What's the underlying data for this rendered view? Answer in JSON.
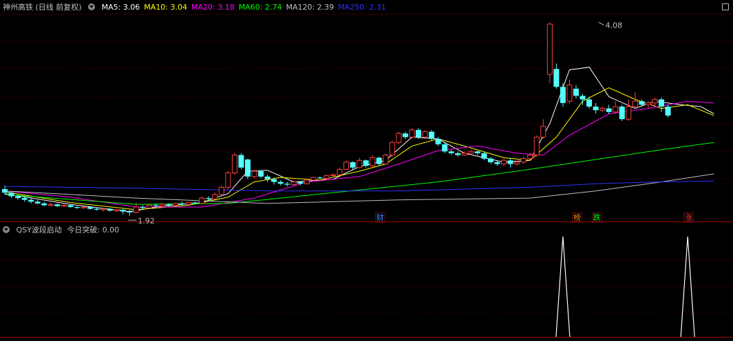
{
  "main_legend": {
    "title": "神州高铁 (日线 前复权)",
    "ma": [
      {
        "label": "MA5: 3.06",
        "color": "#ffffff"
      },
      {
        "label": "MA10: 3.04",
        "color": "#ffff00"
      },
      {
        "label": "MA20: 3.18",
        "color": "#ff00ff"
      },
      {
        "label": "MA60: 2.74",
        "color": "#00ff00"
      },
      {
        "label": "MA120: 2.39",
        "color": "#c0c0c0"
      },
      {
        "label": "MA250: 2.31",
        "color": "#3333ff"
      }
    ]
  },
  "indicator_legend": {
    "name": "QSY波段启动",
    "value_label": "今日突破: 0.00"
  },
  "events": [
    {
      "label": "财",
      "color": "#4488ff",
      "index": 57
    },
    {
      "label": "榜",
      "color": "#ff8800",
      "index": 87
    },
    {
      "label": "跌",
      "color": "#00ff00",
      "index": 90
    },
    {
      "label": "涨",
      "color": "#ff3030",
      "index": 104
    }
  ],
  "colors": {
    "up": "#ff4040",
    "down": "#54ffff",
    "grid": "#800000",
    "border": "#a00000",
    "signal": "#ffffff"
  },
  "chart_data": {
    "type": "candlestick",
    "annotations": {
      "high": {
        "label": "4.08",
        "value": 4.08,
        "index": 90
      },
      "low": {
        "label": "1.92",
        "value": 1.92,
        "index": 19
      }
    },
    "ylim": [
      1.86,
      4.16
    ],
    "candles": [
      [
        2.22,
        2.18,
        2.26,
        2.16
      ],
      [
        2.18,
        2.14,
        2.2,
        2.12
      ],
      [
        2.14,
        2.12,
        2.16,
        2.1
      ],
      [
        2.12,
        2.1,
        2.14,
        2.08
      ],
      [
        2.1,
        2.08,
        2.12,
        2.06
      ],
      [
        2.08,
        2.06,
        2.1,
        2.05
      ],
      [
        2.06,
        2.04,
        2.08,
        2.03
      ],
      [
        2.04,
        2.05,
        2.07,
        2.03
      ],
      [
        2.05,
        2.03,
        2.06,
        2.02
      ],
      [
        2.03,
        2.04,
        2.05,
        2.02
      ],
      [
        2.04,
        2.02,
        2.05,
        2.01
      ],
      [
        2.02,
        2.01,
        2.03,
        2.0
      ],
      [
        2.01,
        2.02,
        2.03,
        2.0
      ],
      [
        2.02,
        2.0,
        2.03,
        1.99
      ],
      [
        2.0,
        1.99,
        2.01,
        1.98
      ],
      [
        1.99,
        2.0,
        2.01,
        1.97
      ],
      [
        2.0,
        1.98,
        2.01,
        1.97
      ],
      [
        1.98,
        1.99,
        2.0,
        1.96
      ],
      [
        1.99,
        1.97,
        2.0,
        1.94
      ],
      [
        1.97,
        1.96,
        1.99,
        1.92
      ],
      [
        1.96,
        2.02,
        2.07,
        1.95
      ],
      [
        2.02,
        2.01,
        2.04,
        1.99
      ],
      [
        2.01,
        2.04,
        2.05,
        2.0
      ],
      [
        2.04,
        2.03,
        2.06,
        2.01
      ],
      [
        2.03,
        2.05,
        2.06,
        2.02
      ],
      [
        2.05,
        2.04,
        2.06,
        2.02
      ],
      [
        2.04,
        2.06,
        2.07,
        2.03
      ],
      [
        2.06,
        2.05,
        2.08,
        2.04
      ],
      [
        2.05,
        2.07,
        2.08,
        2.04
      ],
      [
        2.07,
        2.06,
        2.08,
        2.05
      ],
      [
        2.06,
        2.12,
        2.14,
        2.05
      ],
      [
        2.12,
        2.11,
        2.14,
        2.09
      ],
      [
        2.11,
        2.16,
        2.18,
        2.1
      ],
      [
        2.16,
        2.24,
        2.26,
        2.15
      ],
      [
        2.24,
        2.4,
        2.42,
        2.22
      ],
      [
        2.4,
        2.6,
        2.62,
        2.38
      ],
      [
        2.6,
        2.46,
        2.62,
        2.44
      ],
      [
        2.55,
        2.36,
        2.56,
        2.33
      ],
      [
        2.36,
        2.42,
        2.44,
        2.34
      ],
      [
        2.42,
        2.36,
        2.43,
        2.34
      ],
      [
        2.36,
        2.33,
        2.38,
        2.3
      ],
      [
        2.33,
        2.3,
        2.35,
        2.27
      ],
      [
        2.3,
        2.28,
        2.32,
        2.26
      ],
      [
        2.28,
        2.27,
        2.3,
        2.25
      ],
      [
        2.27,
        2.3,
        2.31,
        2.25
      ],
      [
        2.3,
        2.28,
        2.31,
        2.26
      ],
      [
        2.28,
        2.32,
        2.33,
        2.27
      ],
      [
        2.32,
        2.35,
        2.36,
        2.31
      ],
      [
        2.35,
        2.34,
        2.36,
        2.33
      ],
      [
        2.34,
        2.37,
        2.38,
        2.33
      ],
      [
        2.37,
        2.38,
        2.4,
        2.35
      ],
      [
        2.38,
        2.44,
        2.46,
        2.37
      ],
      [
        2.44,
        2.52,
        2.54,
        2.43
      ],
      [
        2.52,
        2.46,
        2.53,
        2.44
      ],
      [
        2.46,
        2.54,
        2.57,
        2.45
      ],
      [
        2.54,
        2.48,
        2.55,
        2.46
      ],
      [
        2.48,
        2.57,
        2.6,
        2.47
      ],
      [
        2.57,
        2.5,
        2.58,
        2.48
      ],
      [
        2.5,
        2.6,
        2.62,
        2.49
      ],
      [
        2.6,
        2.74,
        2.76,
        2.58
      ],
      [
        2.74,
        2.84,
        2.86,
        2.72
      ],
      [
        2.84,
        2.8,
        2.86,
        2.78
      ],
      [
        2.8,
        2.88,
        2.9,
        2.78
      ],
      [
        2.88,
        2.8,
        2.9,
        2.78
      ],
      [
        2.8,
        2.86,
        2.88,
        2.79
      ],
      [
        2.86,
        2.78,
        2.88,
        2.76
      ],
      [
        2.78,
        2.72,
        2.8,
        2.7
      ],
      [
        2.72,
        2.64,
        2.74,
        2.62
      ],
      [
        2.64,
        2.62,
        2.66,
        2.6
      ],
      [
        2.62,
        2.6,
        2.64,
        2.58
      ],
      [
        2.6,
        2.62,
        2.64,
        2.59
      ],
      [
        2.62,
        2.64,
        2.66,
        2.6
      ],
      [
        2.64,
        2.62,
        2.65,
        2.6
      ],
      [
        2.62,
        2.56,
        2.63,
        2.54
      ],
      [
        2.56,
        2.52,
        2.58,
        2.5
      ],
      [
        2.52,
        2.5,
        2.54,
        2.48
      ],
      [
        2.5,
        2.54,
        2.56,
        2.48
      ],
      [
        2.54,
        2.5,
        2.56,
        2.46
      ],
      [
        2.5,
        2.52,
        2.54,
        2.48
      ],
      [
        2.52,
        2.56,
        2.58,
        2.5
      ],
      [
        2.56,
        2.6,
        2.62,
        2.54
      ],
      [
        2.6,
        2.8,
        2.82,
        2.58
      ],
      [
        2.8,
        2.92,
        3.0,
        2.78
      ],
      [
        3.5,
        4.06,
        4.08,
        3.4
      ],
      [
        3.56,
        3.36,
        3.62,
        3.34
      ],
      [
        3.36,
        3.18,
        3.4,
        3.14
      ],
      [
        3.2,
        3.38,
        3.44,
        3.17
      ],
      [
        3.34,
        3.26,
        3.38,
        3.23
      ],
      [
        3.26,
        3.22,
        3.28,
        3.16
      ],
      [
        3.22,
        3.14,
        3.25,
        3.12
      ],
      [
        3.14,
        3.1,
        3.18,
        3.06
      ],
      [
        3.1,
        3.12,
        3.14,
        3.08
      ],
      [
        3.12,
        3.08,
        3.16,
        3.06
      ],
      [
        3.08,
        3.14,
        3.2,
        3.06
      ],
      [
        3.14,
        3.0,
        3.16,
        2.98
      ],
      [
        3.0,
        3.14,
        3.22,
        2.98
      ],
      [
        3.14,
        3.2,
        3.3,
        3.12
      ],
      [
        3.2,
        3.16,
        3.22,
        3.14
      ],
      [
        3.16,
        3.18,
        3.2,
        3.12
      ],
      [
        3.18,
        3.22,
        3.24,
        3.14
      ],
      [
        3.22,
        3.14,
        3.24,
        3.08
      ],
      [
        3.14,
        3.04,
        3.16,
        3.02
      ]
    ],
    "x_days_as_index": true,
    "ma_lines": {
      "MA5": [
        [
          0,
          2.17
        ],
        [
          10,
          2.05
        ],
        [
          19,
          1.97
        ],
        [
          24,
          2.03
        ],
        [
          30,
          2.07
        ],
        [
          34,
          2.17
        ],
        [
          37,
          2.42
        ],
        [
          40,
          2.43
        ],
        [
          44,
          2.3
        ],
        [
          50,
          2.33
        ],
        [
          54,
          2.47
        ],
        [
          58,
          2.54
        ],
        [
          62,
          2.8
        ],
        [
          66,
          2.78
        ],
        [
          70,
          2.62
        ],
        [
          76,
          2.52
        ],
        [
          80,
          2.54
        ],
        [
          83,
          2.95
        ],
        [
          86,
          3.55
        ],
        [
          89,
          3.58
        ],
        [
          92,
          3.25
        ],
        [
          96,
          3.12
        ],
        [
          99,
          3.2
        ],
        [
          103,
          3.16
        ],
        [
          106,
          3.14
        ],
        [
          108,
          3.06
        ]
      ],
      "MA10": [
        [
          0,
          2.19
        ],
        [
          10,
          2.07
        ],
        [
          20,
          1.99
        ],
        [
          28,
          2.04
        ],
        [
          34,
          2.13
        ],
        [
          38,
          2.3
        ],
        [
          42,
          2.35
        ],
        [
          48,
          2.32
        ],
        [
          54,
          2.42
        ],
        [
          58,
          2.5
        ],
        [
          62,
          2.7
        ],
        [
          66,
          2.78
        ],
        [
          70,
          2.7
        ],
        [
          76,
          2.57
        ],
        [
          80,
          2.54
        ],
        [
          84,
          2.8
        ],
        [
          88,
          3.2
        ],
        [
          92,
          3.35
        ],
        [
          96,
          3.22
        ],
        [
          100,
          3.12
        ],
        [
          104,
          3.16
        ],
        [
          108,
          3.04
        ]
      ],
      "MA20": [
        [
          0,
          2.2
        ],
        [
          10,
          2.13
        ],
        [
          20,
          2.02
        ],
        [
          30,
          2.02
        ],
        [
          38,
          2.12
        ],
        [
          46,
          2.3
        ],
        [
          54,
          2.36
        ],
        [
          60,
          2.5
        ],
        [
          66,
          2.65
        ],
        [
          72,
          2.7
        ],
        [
          78,
          2.62
        ],
        [
          82,
          2.6
        ],
        [
          86,
          2.82
        ],
        [
          92,
          3.06
        ],
        [
          98,
          3.12
        ],
        [
          104,
          3.2
        ],
        [
          108,
          3.18
        ]
      ],
      "MA60": [
        [
          0,
          2.16
        ],
        [
          20,
          2.05
        ],
        [
          34,
          2.06
        ],
        [
          50,
          2.18
        ],
        [
          66,
          2.3
        ],
        [
          80,
          2.44
        ],
        [
          90,
          2.55
        ],
        [
          100,
          2.66
        ],
        [
          108,
          2.74
        ]
      ],
      "MA120": [
        [
          0,
          2.2
        ],
        [
          20,
          2.12
        ],
        [
          40,
          2.06
        ],
        [
          60,
          2.1
        ],
        [
          80,
          2.12
        ],
        [
          90,
          2.2
        ],
        [
          100,
          2.3
        ],
        [
          108,
          2.39
        ]
      ],
      "MA250": [
        [
          0,
          2.25
        ],
        [
          20,
          2.23
        ],
        [
          40,
          2.2
        ],
        [
          60,
          2.2
        ],
        [
          80,
          2.24
        ],
        [
          90,
          2.28
        ],
        [
          100,
          2.3
        ],
        [
          108,
          2.31
        ]
      ]
    },
    "signal": [
      {
        "index": 85,
        "value": 1
      },
      {
        "index": 104,
        "value": 1
      }
    ]
  }
}
